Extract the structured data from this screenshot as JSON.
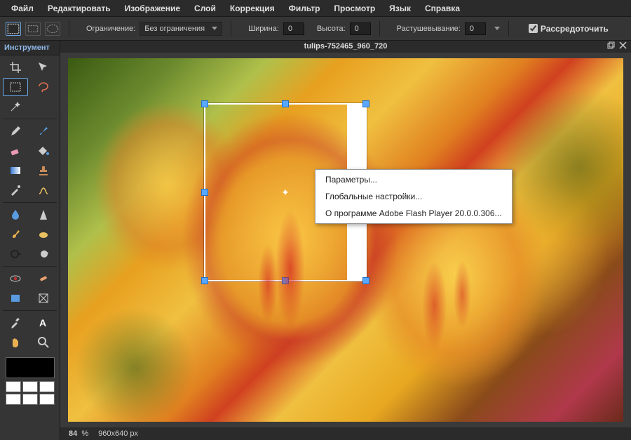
{
  "menu": {
    "items": [
      "Файл",
      "Редактировать",
      "Изображение",
      "Слой",
      "Коррекция",
      "Фильтр",
      "Просмотр",
      "Язык",
      "Справка"
    ]
  },
  "options": {
    "constraint_label": "Ограничение:",
    "constraint_value": "Без ограничения",
    "width_label": "Ширина:",
    "width_value": "0",
    "height_label": "Высота:",
    "height_value": "0",
    "feather_label": "Растушевывание:",
    "feather_value": "0",
    "scatter_label": "Рассредоточить"
  },
  "sidebar": {
    "title": "Инструмент"
  },
  "document": {
    "title": "tulips-752465_960_720"
  },
  "context_menu": {
    "items": [
      "Параметры...",
      "Глобальные настройки...",
      "О программе Adobe Flash Player 20.0.0.306..."
    ]
  },
  "status": {
    "zoom": "84",
    "zoom_unit": "%",
    "dims": "960x640 px"
  },
  "colors": {
    "accent": "#5aa7ff"
  }
}
